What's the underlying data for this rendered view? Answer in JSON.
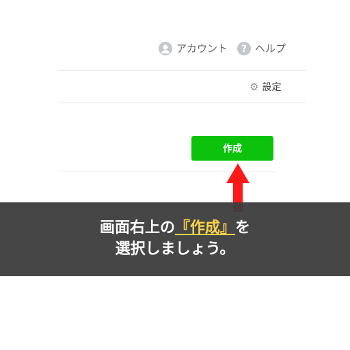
{
  "header": {
    "account_label": "アカウント",
    "help_label": "ヘルプ"
  },
  "toolbar": {
    "settings_label": "設定"
  },
  "main": {
    "create_label": "作成"
  },
  "instruction": {
    "line1_before": "画面右上の",
    "line1_highlight": "『作成』",
    "line1_after": "を",
    "line2": "選択しましょう。"
  },
  "colors": {
    "button_green": "#0cc20c",
    "arrow_red": "#ff1a1a",
    "highlight_yellow": "#ffd54a",
    "banner_bg": "#3c3c3c"
  },
  "icons": [
    "user-icon",
    "help-icon",
    "gear-icon",
    "arrow-up-icon"
  ]
}
